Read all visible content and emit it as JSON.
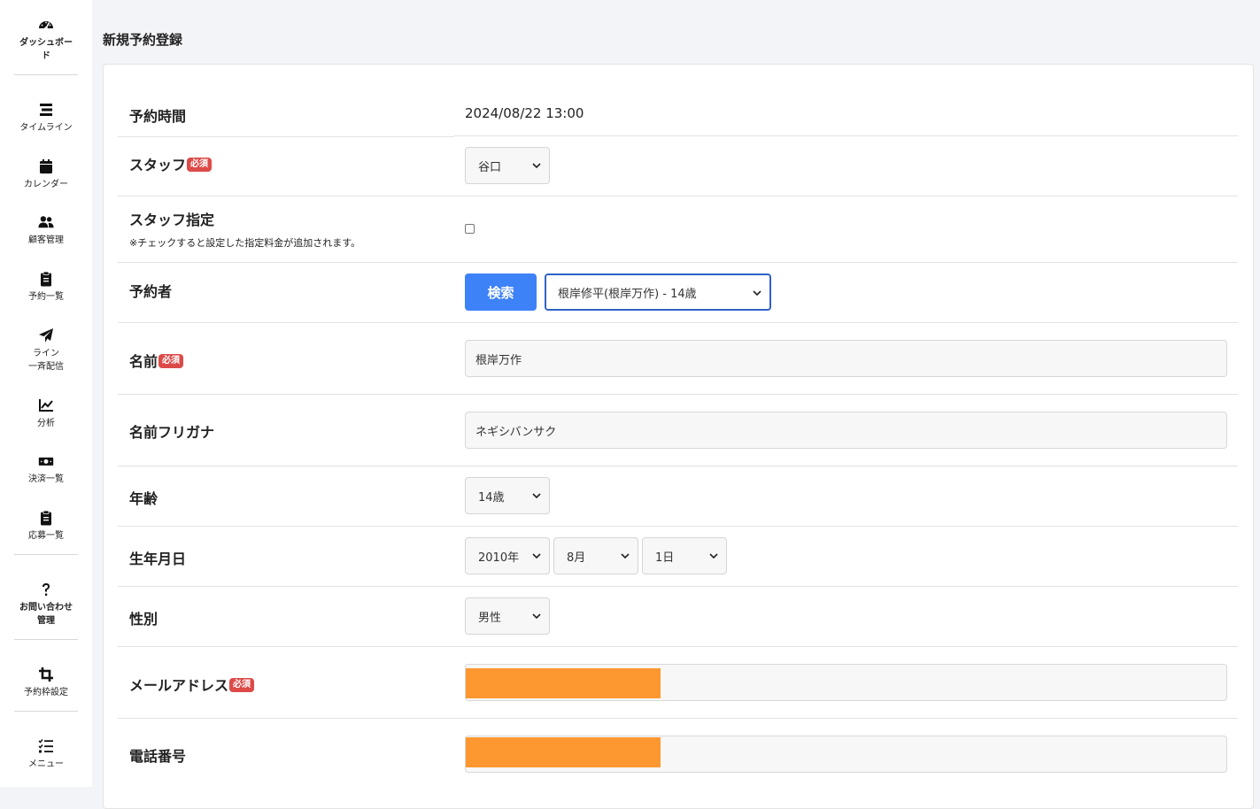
{
  "sidebar": {
    "items": [
      {
        "label": "ダッシュボー\nド",
        "icon": "dashboard-gauge-icon"
      },
      {
        "label": "タイムライン",
        "icon": "timeline-bars-icon"
      },
      {
        "label": "カレンダー",
        "icon": "calendar-icon"
      },
      {
        "label": "顧客管理",
        "icon": "users-icon"
      },
      {
        "label": "予約一覧",
        "icon": "clipboard-icon"
      },
      {
        "label": "ライン\n一斉配信",
        "icon": "paper-plane-icon"
      },
      {
        "label": "分析",
        "icon": "line-chart-icon"
      },
      {
        "label": "決済一覧",
        "icon": "money-bill-icon"
      },
      {
        "label": "応募一覧",
        "icon": "clipboard-list-icon"
      },
      {
        "label": "お問い合わせ\n管理",
        "icon": "question-icon"
      },
      {
        "label": "予約枠設定",
        "icon": "crop-icon"
      },
      {
        "label": "メニュー",
        "icon": "checklist-icon"
      }
    ]
  },
  "page": {
    "title": "新規予約登録"
  },
  "required_badge": "必須",
  "form": {
    "reservation_time": {
      "label": "予約時間",
      "value": "2024/08/22 13:00"
    },
    "staff": {
      "label": "スタッフ",
      "selected": "谷口"
    },
    "staff_designation": {
      "label": "スタッフ指定",
      "note": "※チェックすると設定した指定料金が追加されます。",
      "checked": false
    },
    "reserver": {
      "label": "予約者",
      "search_button": "検索",
      "selected": "根岸修平(根岸万作) - 14歳"
    },
    "name": {
      "label": "名前",
      "value": "根岸万作"
    },
    "name_kana": {
      "label": "名前フリガナ",
      "value": "ネギシバンサク"
    },
    "age": {
      "label": "年齢",
      "selected": "14歳"
    },
    "birthdate": {
      "label": "生年月日",
      "year": "2010年",
      "month": "8月",
      "day": "1日"
    },
    "gender": {
      "label": "性別",
      "selected": "男性"
    },
    "email": {
      "label": "メールアドレス",
      "value": ""
    },
    "phone": {
      "label": "電話番号",
      "value": ""
    }
  },
  "colors": {
    "primary": "#3e82f7",
    "required_badge": "#dc4b48",
    "redaction": "#fd9730",
    "focus_border": "#2f63c7"
  }
}
